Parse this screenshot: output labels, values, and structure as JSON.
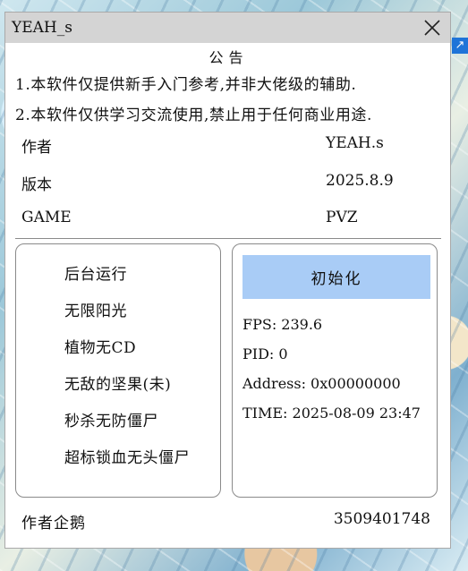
{
  "desktop": {
    "arrow_icon": "↗"
  },
  "window": {
    "title": "YEAH_s",
    "close_icon": "close-icon"
  },
  "notice": {
    "title": "公告",
    "lines": [
      "1.本软件仅提供新手入门参考,并非大佬级的辅助.",
      "2.本软件仅供学习交流使用,禁止用于任何商业用途."
    ]
  },
  "info": [
    {
      "label": "作者",
      "value": "YEAH.s"
    },
    {
      "label": "版本",
      "value": "2025.8.9"
    },
    {
      "label": "GAME",
      "value": "PVZ"
    }
  ],
  "features": [
    "后台运行",
    "无限阳光",
    "植物无CD",
    "无敌的坚果(未)",
    "秒杀无防僵尸",
    "超标锁血无头僵尸"
  ],
  "status": {
    "init_button": "初始化",
    "button_color": "#a9ccf6",
    "fps": "FPS: 239.6",
    "pid": "PID: 0",
    "address": "Address: 0x00000000",
    "time": "TIME: 2025-08-09 23:47"
  },
  "footer": {
    "label": "作者企鹅",
    "qq": "3509401748"
  }
}
